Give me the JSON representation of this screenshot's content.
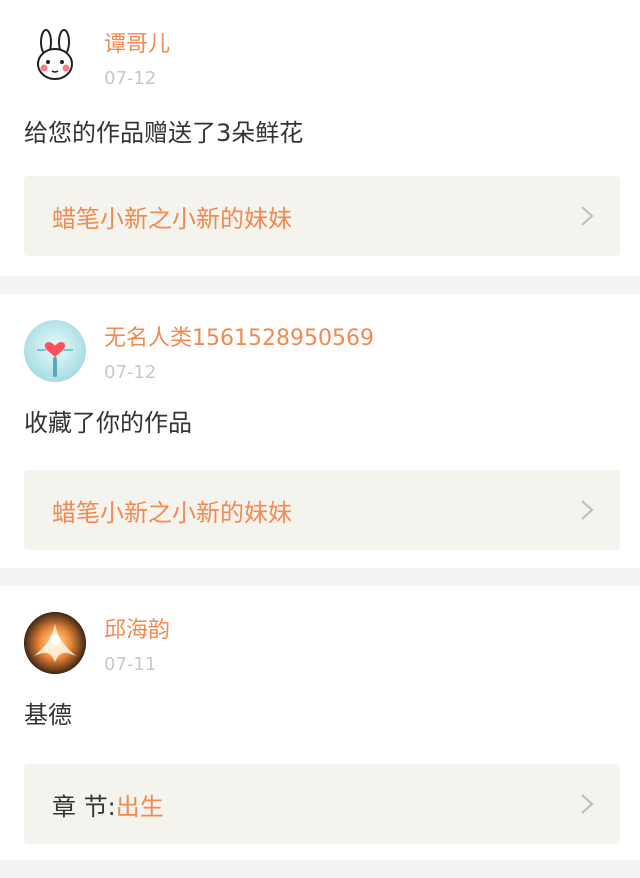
{
  "feed": [
    {
      "user": "谭哥儿",
      "date": "07-12",
      "avatar_icon": "bunny-avatar-icon",
      "message": "给您的作品赠送了3朵鲜花",
      "work_title": "蜡笔小新之小新的妹妹",
      "chevron_icon": "chevron-right-icon"
    },
    {
      "user": "无名人类1561528950569",
      "date": "07-12",
      "avatar_icon": "heart-figure-avatar-icon",
      "message": "收藏了你的作品",
      "work_title": "蜡笔小新之小新的妹妹",
      "chevron_icon": "chevron-right-icon"
    },
    {
      "user": "邱海韵",
      "date": "07-11",
      "avatar_icon": "fire-bird-avatar-icon",
      "message": "基德",
      "chapter_prefix": "章 节:",
      "chapter_title": "出生",
      "chevron_icon": "chevron-right-icon"
    }
  ],
  "colors": {
    "accent": "#f08a50",
    "card_bg": "#ffffff",
    "link_bg": "#f4f3ee",
    "date": "#c8c8c8"
  }
}
